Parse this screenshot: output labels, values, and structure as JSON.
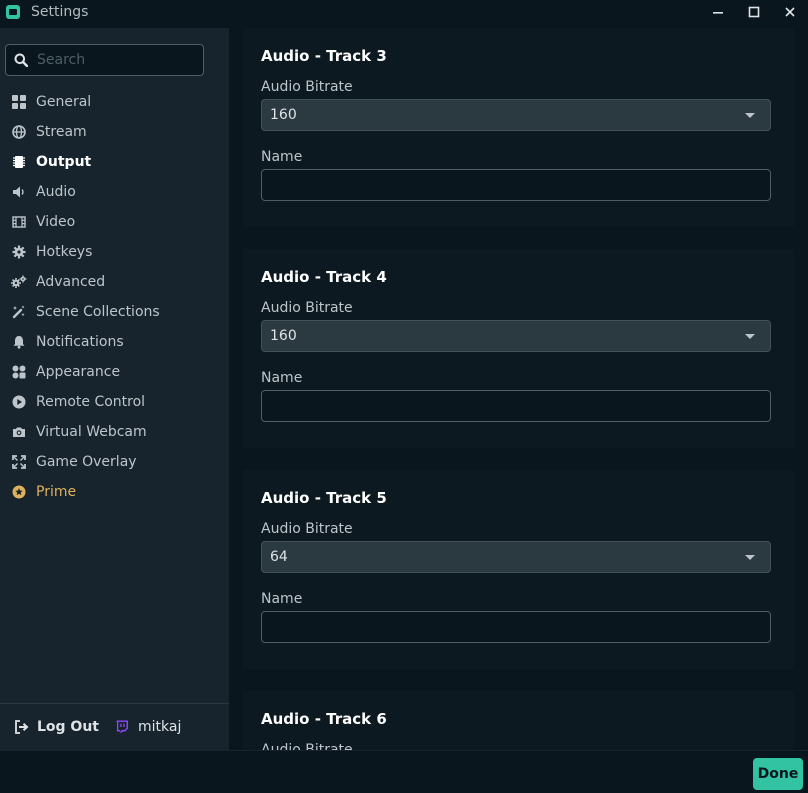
{
  "window": {
    "title": "Settings",
    "minimize_icon": "minimize-icon",
    "maximize_icon": "maximize-icon",
    "close_icon": "close-icon"
  },
  "search": {
    "placeholder": "Search",
    "value": ""
  },
  "sidebar": {
    "items": [
      {
        "label": "General",
        "icon": "grid-icon"
      },
      {
        "label": "Stream",
        "icon": "globe-icon"
      },
      {
        "label": "Output",
        "icon": "chip-icon",
        "active": true
      },
      {
        "label": "Audio",
        "icon": "speaker-icon"
      },
      {
        "label": "Video",
        "icon": "film-icon"
      },
      {
        "label": "Hotkeys",
        "icon": "gear-icon"
      },
      {
        "label": "Advanced",
        "icon": "gears-icon"
      },
      {
        "label": "Scene Collections",
        "icon": "magic-wand-icon"
      },
      {
        "label": "Notifications",
        "icon": "bell-icon"
      },
      {
        "label": "Appearance",
        "icon": "palette-icon"
      },
      {
        "label": "Remote Control",
        "icon": "play-circle-icon"
      },
      {
        "label": "Virtual Webcam",
        "icon": "camera-icon"
      },
      {
        "label": "Game Overlay",
        "icon": "expand-icon"
      },
      {
        "label": "Prime",
        "icon": "prime-badge-icon",
        "accent": "#e0b25b"
      }
    ],
    "footer": {
      "logout_label": "Log Out",
      "username": "mitkaj",
      "platform_icon": "twitch-icon"
    }
  },
  "main": {
    "sections": [
      {
        "title": "Audio - Track 3",
        "bitrate_label": "Audio Bitrate",
        "bitrate_value": "160",
        "name_label": "Name",
        "name_value": ""
      },
      {
        "title": "Audio - Track 4",
        "bitrate_label": "Audio Bitrate",
        "bitrate_value": "160",
        "name_label": "Name",
        "name_value": ""
      },
      {
        "title": "Audio - Track 5",
        "bitrate_label": "Audio Bitrate",
        "bitrate_value": "64",
        "name_label": "Name",
        "name_value": ""
      },
      {
        "title": "Audio - Track 6",
        "bitrate_label": "Audio Bitrate"
      }
    ]
  },
  "footer": {
    "done_label": "Done"
  },
  "colors": {
    "accent": "#31c3a2",
    "prime": "#e0b25b",
    "sidebar_bg": "#17242d",
    "window_bg": "#09161d"
  }
}
